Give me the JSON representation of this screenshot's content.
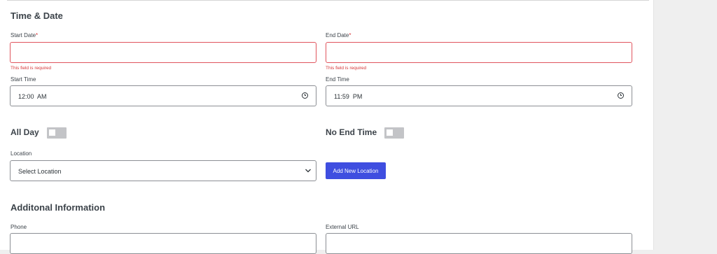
{
  "time_date": {
    "title": "Time & Date",
    "start_date": {
      "label": "Start Date",
      "required_mark": "*",
      "value": "",
      "error": "This field is required"
    },
    "end_date": {
      "label": "End Date",
      "required_mark": "*",
      "value": "",
      "error": "This field is required"
    },
    "start_time": {
      "label": "Start Time",
      "value": "12:00  AM",
      "icon": "clock-icon"
    },
    "end_time": {
      "label": "End Time",
      "value": "11:59  PM",
      "icon": "clock-icon"
    },
    "all_day": {
      "label": "All Day",
      "on": false
    },
    "no_end_time": {
      "label": "No End Time",
      "on": false
    },
    "location": {
      "label": "Location",
      "selected": "Select Location",
      "icon": "chevron-down-icon"
    },
    "add_location_label": "Add New Location"
  },
  "additional": {
    "title": "Additonal Information",
    "phone": {
      "label": "Phone",
      "value": ""
    },
    "external_url": {
      "label": "External URL",
      "value": ""
    }
  },
  "colors": {
    "accent": "#3f4ee0",
    "error": "#d63638",
    "toggle_off": "#c3c4c7"
  }
}
